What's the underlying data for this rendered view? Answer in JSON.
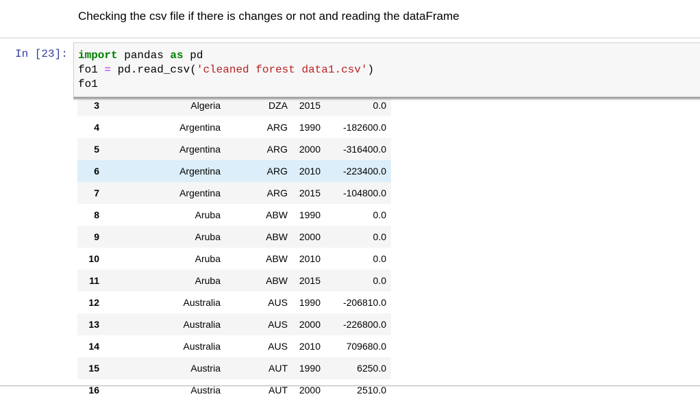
{
  "markdown_text": "Checking the csv file if there is changes or not and reading the dataFrame",
  "prompt": "In [23]:",
  "code": {
    "line1": {
      "kw1": "import",
      "t1": " pandas ",
      "kw2": "as",
      "t2": " pd"
    },
    "line2": {
      "t1": "fo1 ",
      "op": "=",
      "t2": " pd.read_csv(",
      "str": "'cleaned forest data1.csv'",
      "t3": ")"
    },
    "line3": "fo1"
  },
  "table_rows": [
    {
      "idx": "3",
      "country": "Algeria",
      "code": "DZA",
      "year": "2015",
      "value": "0.0"
    },
    {
      "idx": "4",
      "country": "Argentina",
      "code": "ARG",
      "year": "1990",
      "value": "-182600.0"
    },
    {
      "idx": "5",
      "country": "Argentina",
      "code": "ARG",
      "year": "2000",
      "value": "-316400.0"
    },
    {
      "idx": "6",
      "country": "Argentina",
      "code": "ARG",
      "year": "2010",
      "value": "-223400.0"
    },
    {
      "idx": "7",
      "country": "Argentina",
      "code": "ARG",
      "year": "2015",
      "value": "-104800.0"
    },
    {
      "idx": "8",
      "country": "Aruba",
      "code": "ABW",
      "year": "1990",
      "value": "0.0"
    },
    {
      "idx": "9",
      "country": "Aruba",
      "code": "ABW",
      "year": "2000",
      "value": "0.0"
    },
    {
      "idx": "10",
      "country": "Aruba",
      "code": "ABW",
      "year": "2010",
      "value": "0.0"
    },
    {
      "idx": "11",
      "country": "Aruba",
      "code": "ABW",
      "year": "2015",
      "value": "0.0"
    },
    {
      "idx": "12",
      "country": "Australia",
      "code": "AUS",
      "year": "1990",
      "value": "-206810.0"
    },
    {
      "idx": "13",
      "country": "Australia",
      "code": "AUS",
      "year": "2000",
      "value": "-226800.0"
    },
    {
      "idx": "14",
      "country": "Australia",
      "code": "AUS",
      "year": "2010",
      "value": "709680.0"
    },
    {
      "idx": "15",
      "country": "Austria",
      "code": "AUT",
      "year": "1990",
      "value": "6250.0"
    },
    {
      "idx": "16",
      "country": "Austria",
      "code": "AUT",
      "year": "2000",
      "value": "2510.0"
    }
  ],
  "highlighted_index": "6"
}
